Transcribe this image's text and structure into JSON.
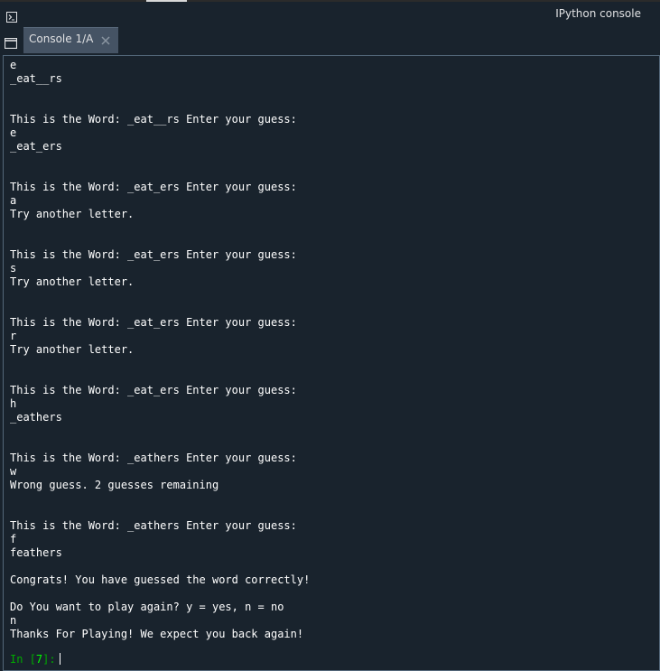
{
  "window": {
    "title": "IPython console"
  },
  "tabs": [
    {
      "label": "Console 1/A"
    }
  ],
  "console": {
    "lines": [
      "e",
      "_eat__rs",
      "",
      "",
      "This is the Word: _eat__rs Enter your guess:",
      "e",
      "_eat_ers",
      "",
      "",
      "This is the Word: _eat_ers Enter your guess:",
      "a",
      "Try another letter.",
      "",
      "",
      "This is the Word: _eat_ers Enter your guess:",
      "s",
      "Try another letter.",
      "",
      "",
      "This is the Word: _eat_ers Enter your guess:",
      "r",
      "Try another letter.",
      "",
      "",
      "This is the Word: _eat_ers Enter your guess:",
      "h",
      "_eathers",
      "",
      "",
      "This is the Word: _eathers Enter your guess:",
      "w",
      "Wrong guess. 2 guesses remaining",
      "",
      "",
      "This is the Word: _eathers Enter your guess:",
      "f",
      "feathers",
      "",
      "Congrats! You have guessed the word correctly!",
      "",
      "Do You want to play again? y = yes, n = no",
      "n",
      "Thanks For Playing! We expect you back again!"
    ],
    "prompt": {
      "prefix": "In [",
      "number": "7",
      "suffix": "]:"
    }
  },
  "colors": {
    "background": "#19232d",
    "tab_active": "#455364",
    "text": "#ffffff",
    "prompt": "#00aa00",
    "prompt_number": "#00ff00"
  },
  "icons": {
    "pane": "terminal-pane-icon",
    "options": "options-menu-icon",
    "tab_close": "close-icon"
  }
}
